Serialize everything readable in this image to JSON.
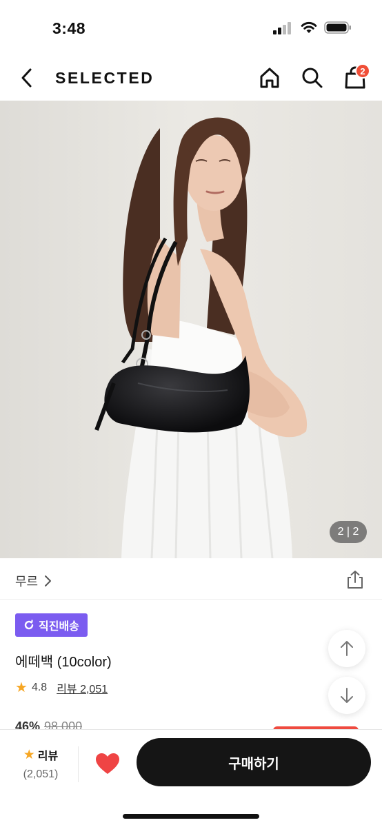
{
  "status_bar": {
    "time": "3:48"
  },
  "header": {
    "brand": "SELECTED",
    "cart_count": "2"
  },
  "gallery": {
    "counter": "2 | 2"
  },
  "product": {
    "brand_name": "무르",
    "delivery_badge": "직진배송",
    "name": "에떼백 (10color)",
    "rating": "4.8",
    "review_link": "리뷰 2,051",
    "discount": "46%",
    "original_price": "98,000"
  },
  "bottom_bar": {
    "review_label": "리뷰",
    "review_count": "(2,051)",
    "buy_label": "구매하기"
  },
  "colors": {
    "badge": "#7b5cf0",
    "cart_badge": "#f04e37",
    "heart": "#ef4444",
    "star": "#f6a623",
    "buy_button": "#151515"
  },
  "icons": [
    "signal-icon",
    "wifi-icon",
    "battery-icon",
    "back-chevron-icon",
    "home-icon",
    "search-icon",
    "shopping-bag-icon",
    "chevron-right-icon",
    "share-icon",
    "refresh-icon",
    "star-icon",
    "arrow-up-icon",
    "arrow-down-icon",
    "heart-icon"
  ]
}
